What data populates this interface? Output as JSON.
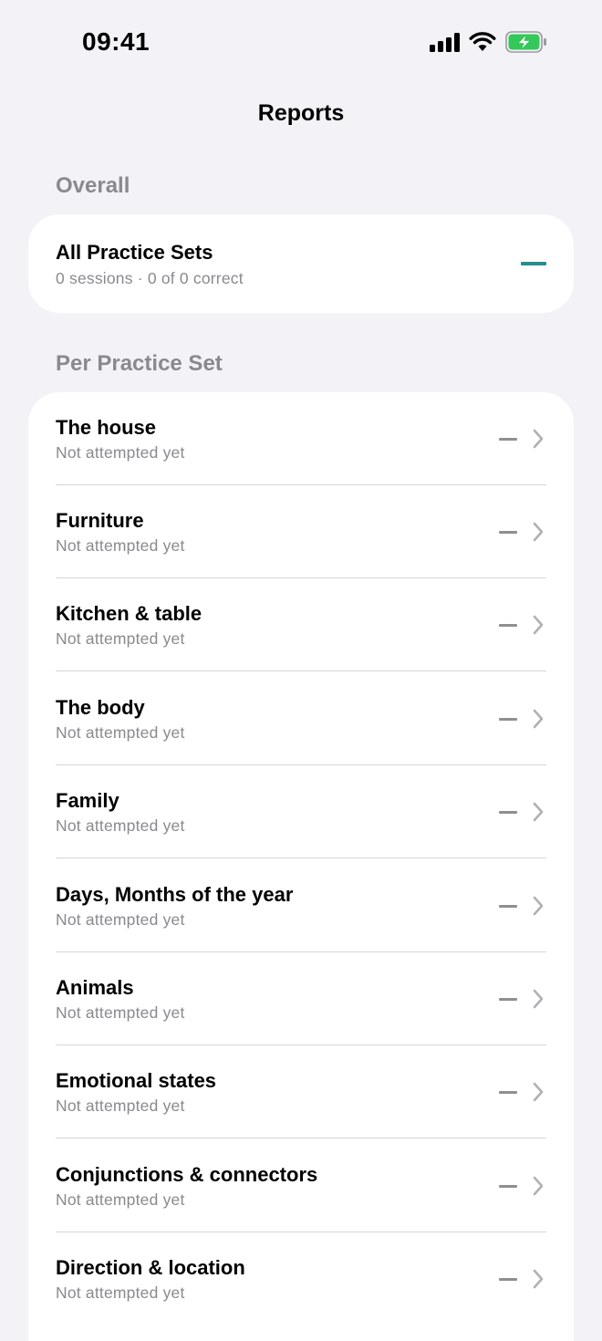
{
  "status": {
    "time": "09:41"
  },
  "nav": {
    "title": "Reports"
  },
  "overall": {
    "header": "Overall",
    "title": "All Practice Sets",
    "subtitle": "0 sessions  ·  0 of 0 correct"
  },
  "per_set": {
    "header": "Per Practice Set",
    "items": [
      {
        "title": "The house",
        "subtitle": "Not attempted yet"
      },
      {
        "title": "Furniture",
        "subtitle": "Not attempted yet"
      },
      {
        "title": "Kitchen & table",
        "subtitle": "Not attempted yet"
      },
      {
        "title": "The body",
        "subtitle": "Not attempted yet"
      },
      {
        "title": "Family",
        "subtitle": "Not attempted yet"
      },
      {
        "title": "Days, Months of the year",
        "subtitle": "Not attempted yet"
      },
      {
        "title": "Animals",
        "subtitle": "Not attempted yet"
      },
      {
        "title": "Emotional states",
        "subtitle": "Not attempted yet"
      },
      {
        "title": "Conjunctions & connectors",
        "subtitle": "Not attempted yet"
      },
      {
        "title": "Direction & location",
        "subtitle": "Not attempted yet"
      }
    ]
  },
  "colors": {
    "accent": "#2a8c8c",
    "battery": "#34c759",
    "background": "#f2f2f7"
  }
}
